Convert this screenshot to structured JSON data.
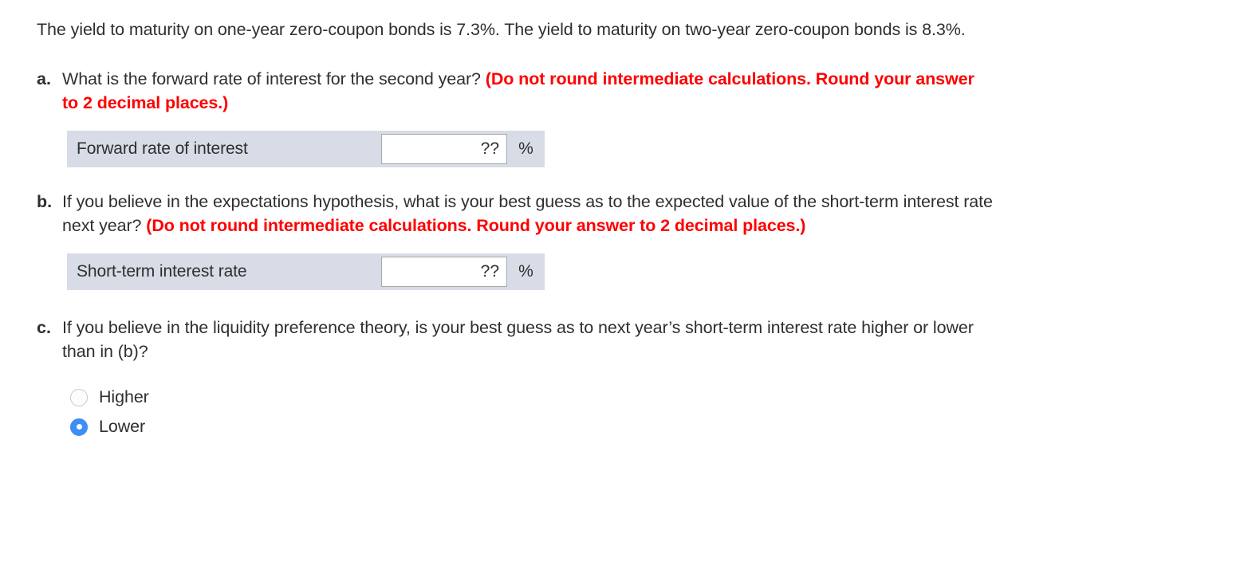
{
  "problem": {
    "intro": "The yield to maturity on one-year zero-coupon bonds is 7.3%. The yield to maturity on two-year zero-coupon bonds is 8.3%."
  },
  "parts": {
    "a": {
      "letter": "a.",
      "prompt": "What is the forward rate of interest for the second year? ",
      "hint": "(Do not round intermediate calculations. Round your answer to 2 decimal places.)",
      "answer": {
        "label": "Forward rate of interest",
        "value": "??",
        "placeholder": "",
        "unit": "%"
      }
    },
    "b": {
      "letter": "b.",
      "prompt": "If you believe in the expectations hypothesis, what is your best guess as to the expected value of the short-term interest rate next year? ",
      "hint": "(Do not round intermediate calculations. Round your answer to 2 decimal places.)",
      "answer": {
        "label": "Short-term interest rate",
        "value": "??",
        "placeholder": "",
        "unit": "%"
      }
    },
    "c": {
      "letter": "c.",
      "prompt": "If you believe in the liquidity preference theory, is your best guess as to next year’s short-term interest rate higher or lower than in (b)?",
      "options": [
        {
          "label": "Higher",
          "selected": false
        },
        {
          "label": "Lower",
          "selected": true
        }
      ]
    }
  },
  "colors": {
    "hint_red": "#ff0000",
    "answer_row_bg": "#d7dce6",
    "radio_selected": "#3d8ef5",
    "text": "#2f2f2f"
  }
}
